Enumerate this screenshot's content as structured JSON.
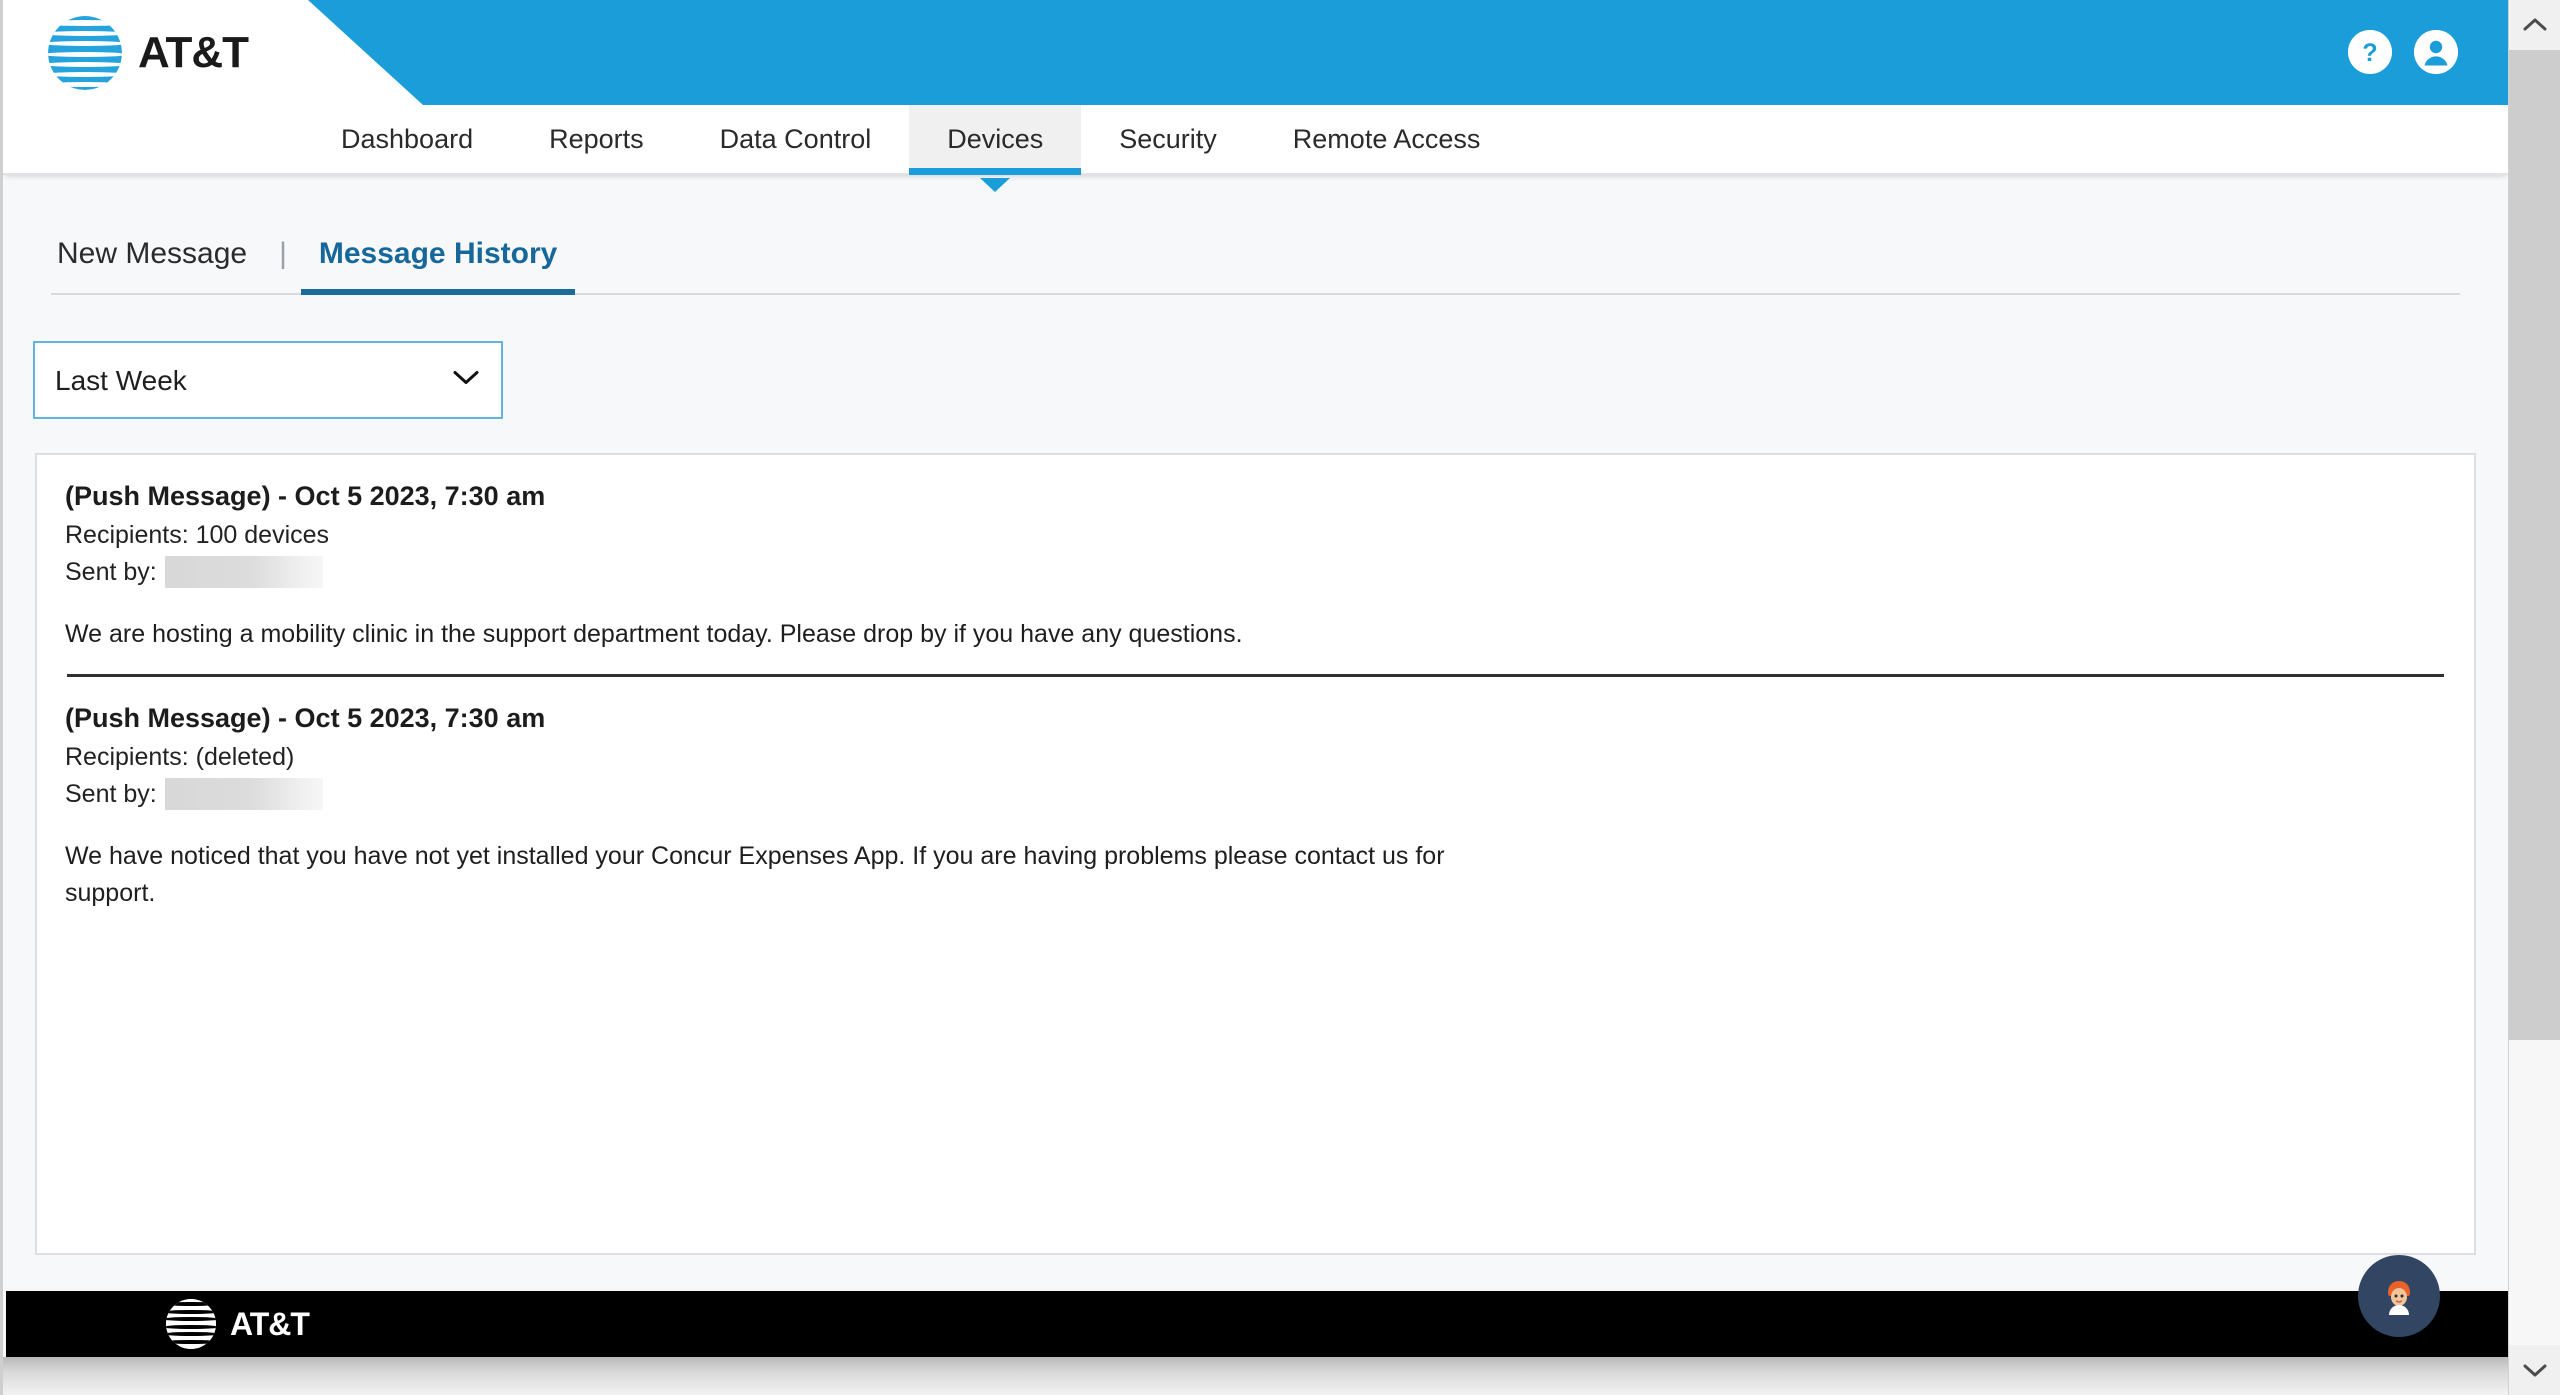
{
  "brand": {
    "name": "AT&T",
    "banner_color": "#1b9dd9",
    "footer_bg": "#000000"
  },
  "topbar": {
    "help_icon": "help-circle-icon",
    "account_icon": "account-circle-icon"
  },
  "mainnav": {
    "items": [
      {
        "label": "Dashboard",
        "active": false
      },
      {
        "label": "Reports",
        "active": false
      },
      {
        "label": "Data Control",
        "active": false
      },
      {
        "label": "Devices",
        "active": true
      },
      {
        "label": "Security",
        "active": false
      },
      {
        "label": "Remote Access",
        "active": false
      }
    ],
    "active_color": "#1b9dd9"
  },
  "subtabs": {
    "new_message": "New Message",
    "separator": "|",
    "message_history": "Message History",
    "active": "Message History",
    "active_color": "#1a6d96"
  },
  "filter": {
    "selected": "Last Week",
    "options": [
      "Last Week"
    ],
    "chevron_icon": "chevron-down-icon",
    "border_color": "#5fb5de"
  },
  "messages": [
    {
      "title": "(Push Message) - Oct 5 2023, 7:30 am",
      "recipients_label": "Recipients:",
      "recipients_value": "100 devices",
      "sent_by_label": "Sent by:",
      "sent_by_value": "",
      "body": "We are hosting a mobility clinic in the support department today. Please drop by if you have any questions."
    },
    {
      "title": "(Push Message) - Oct 5 2023, 7:30 am",
      "recipients_label": "Recipients:",
      "recipients_value": "(deleted)",
      "sent_by_label": "Sent by:",
      "sent_by_value": "",
      "body": "We have noticed that you have not yet installed your Concur Expenses App. If you are having problems please contact us for support."
    }
  ],
  "chat": {
    "icon": "agent-avatar-icon",
    "bg_color": "#324563"
  },
  "footer": {
    "brand": "AT&T"
  },
  "scrollbar": {
    "up_icon": "chevron-up-icon",
    "down_icon": "chevron-down-icon"
  }
}
